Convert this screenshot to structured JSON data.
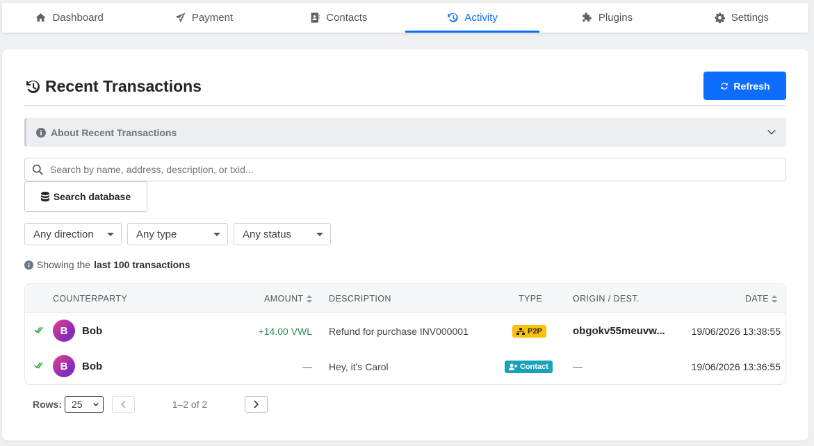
{
  "nav": {
    "tabs": [
      {
        "label": "Dashboard",
        "icon": "home-icon",
        "active": false
      },
      {
        "label": "Payment",
        "icon": "send-icon",
        "active": false
      },
      {
        "label": "Contacts",
        "icon": "address-book-icon",
        "active": false
      },
      {
        "label": "Activity",
        "icon": "history-icon",
        "active": true
      },
      {
        "label": "Plugins",
        "icon": "puzzle-icon",
        "active": false
      },
      {
        "label": "Settings",
        "icon": "gear-icon",
        "active": false
      }
    ]
  },
  "header": {
    "title": "Recent Transactions",
    "refresh_label": "Refresh"
  },
  "about": {
    "label": "About Recent Transactions"
  },
  "search": {
    "placeholder": "Search by name, address, description, or txid...",
    "value": "",
    "db_button_label": "Search database"
  },
  "filters": {
    "direction": "Any direction",
    "type": "Any type",
    "status": "Any status"
  },
  "showing": {
    "prefix": "Showing the",
    "emphasis": "last 100 transactions"
  },
  "table": {
    "columns": {
      "counterparty": "COUNTERPARTY",
      "amount": "AMOUNT",
      "description": "DESCRIPTION",
      "type": "TYPE",
      "origin": "ORIGIN / DEST.",
      "date": "DATE"
    },
    "rows": [
      {
        "initial": "B",
        "name": "Bob",
        "amount": "+14.00 VWL",
        "description": "Refund for purchase INV000001",
        "type": "P2P",
        "origin": "obgokv55meuvw...",
        "date": "19/06/2026 13:38:55"
      },
      {
        "initial": "B",
        "name": "Bob",
        "amount": "—",
        "description": "Hey, it's Carol",
        "type": "Contact",
        "origin": "—",
        "date": "19/06/2026 13:36:55"
      }
    ]
  },
  "pager": {
    "rows_label": "Rows:",
    "rows_value": "25",
    "info": "1–2 of 2"
  },
  "colors": {
    "accent": "#0d6efd",
    "positive_amount": "#2e8b57",
    "p2p_badge": "#ffc107",
    "contact_badge": "#17a2b8"
  }
}
